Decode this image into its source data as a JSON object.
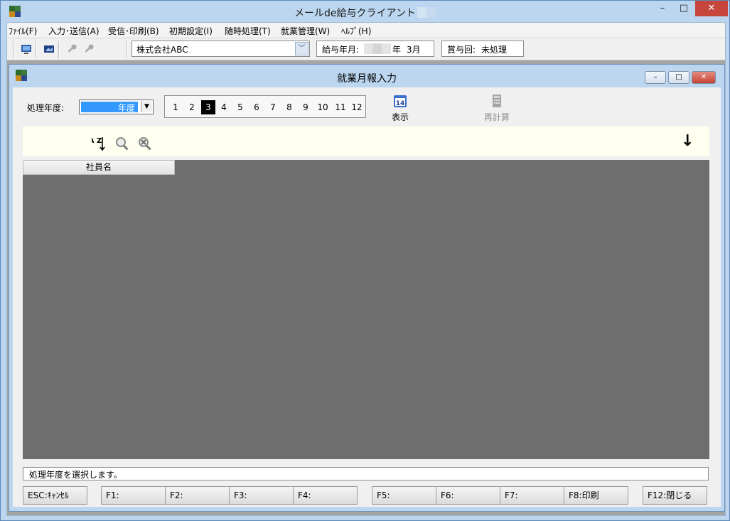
{
  "window": {
    "title": "メールde給与クライアント",
    "controls": {
      "minimize": "–",
      "maximize": "□",
      "close": "✕"
    }
  },
  "menu": {
    "items": [
      {
        "label": "ﾌｧｲﾙ(F)"
      },
      {
        "label": "入力･送信(A)"
      },
      {
        "label": "受信･印刷(B)"
      },
      {
        "label": "初期設定(I)"
      },
      {
        "label": "随時処理(T)"
      },
      {
        "label": "就業管理(W)"
      },
      {
        "label": "ﾍﾙﾌﾟ(H)"
      }
    ]
  },
  "toolbar": {
    "company": "株式会社ABC",
    "pay_label": "給与年月:",
    "pay_year_suffix": "年",
    "pay_month": "3月",
    "bonus_label": "賞与回:",
    "bonus_value": "未処理"
  },
  "child": {
    "title": "就業月報入力",
    "year_label": "処理年度:",
    "year_value": "年度",
    "months": [
      "1",
      "2",
      "3",
      "4",
      "5",
      "6",
      "7",
      "8",
      "9",
      "10",
      "11",
      "12"
    ],
    "selected_month": "3",
    "display_button": "表示",
    "recalc_button": "再計算",
    "display_icon_text": "14",
    "column_header": "社員名",
    "status_text": "処理年度を選択します。",
    "sort_icon_text": "A Z",
    "down_arrow": "↓"
  },
  "fkeys": [
    {
      "label": "ESC:ｷｬﾝｾﾙ"
    },
    {
      "label": "F1:"
    },
    {
      "label": "F2:"
    },
    {
      "label": "F3:"
    },
    {
      "label": "F4:"
    },
    {
      "label": "F5:"
    },
    {
      "label": "F6:"
    },
    {
      "label": "F7:"
    },
    {
      "label": "F8:印刷"
    },
    {
      "label": "F12:閉じる"
    }
  ],
  "colors": {
    "window_frame": "#bcd6f0",
    "close_red": "#c7463b",
    "selection_blue": "#3399ff",
    "grid_gray": "#6e6e6e"
  }
}
